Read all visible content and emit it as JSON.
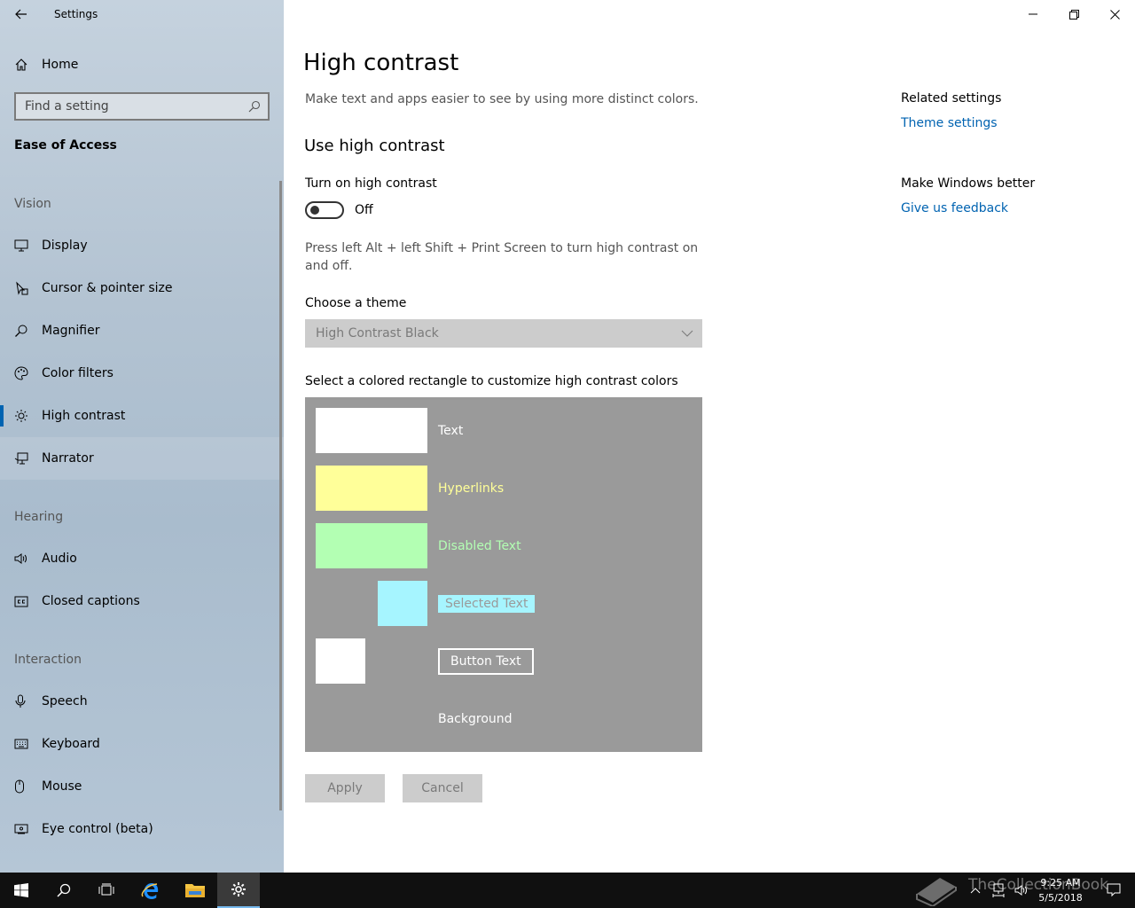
{
  "window": {
    "app_title": "Settings"
  },
  "sidebar": {
    "home_label": "Home",
    "search_placeholder": "Find a setting",
    "section_title": "Ease of Access",
    "groups": {
      "vision": "Vision",
      "hearing": "Hearing",
      "interaction": "Interaction"
    },
    "items": [
      {
        "label": "Display",
        "icon": "monitor-icon"
      },
      {
        "label": "Cursor & pointer size",
        "icon": "cursor-icon"
      },
      {
        "label": "Magnifier",
        "icon": "magnifier-icon"
      },
      {
        "label": "Color filters",
        "icon": "palette-icon"
      },
      {
        "label": "High contrast",
        "icon": "brightness-icon",
        "selected": true
      },
      {
        "label": "Narrator",
        "icon": "narrator-icon"
      },
      {
        "label": "Audio",
        "icon": "speaker-icon"
      },
      {
        "label": "Closed captions",
        "icon": "captions-icon"
      },
      {
        "label": "Speech",
        "icon": "microphone-icon"
      },
      {
        "label": "Keyboard",
        "icon": "keyboard-icon"
      },
      {
        "label": "Mouse",
        "icon": "mouse-icon"
      },
      {
        "label": "Eye control (beta)",
        "icon": "eye-icon"
      }
    ]
  },
  "main": {
    "title": "High contrast",
    "description": "Make text and apps easier to see by using more distinct colors.",
    "subheading": "Use high contrast",
    "toggle_label": "Turn on high contrast",
    "toggle_state": "Off",
    "shortcut_hint": "Press left Alt + left Shift + Print Screen to turn high contrast on and off.",
    "theme_label": "Choose a theme",
    "theme_value": "High Contrast Black",
    "palette_label": "Select a colored rectangle to customize high contrast colors",
    "palette": {
      "text": {
        "label": "Text",
        "color": "#ffffff"
      },
      "hyperlinks": {
        "label": "Hyperlinks",
        "color": "#ffff99"
      },
      "disabled": {
        "label": "Disabled Text",
        "color": "#b3ffb3"
      },
      "selected": {
        "label": "Selected Text",
        "color": "#a6f5ff"
      },
      "button": {
        "label": "Button Text",
        "color": "#ffffff"
      },
      "background": {
        "label": "Background",
        "color": "#9a9a9a"
      }
    },
    "apply_label": "Apply",
    "cancel_label": "Cancel"
  },
  "related": {
    "heading": "Related settings",
    "theme_link": "Theme settings",
    "feedback_heading": "Make Windows better",
    "feedback_link": "Give us feedback"
  },
  "taskbar": {
    "time": "9:25 AM",
    "date": "5/5/2018",
    "watermark": "TheCollectionBook"
  },
  "colors": {
    "accent": "#0063b1",
    "link": "#0063b1"
  }
}
